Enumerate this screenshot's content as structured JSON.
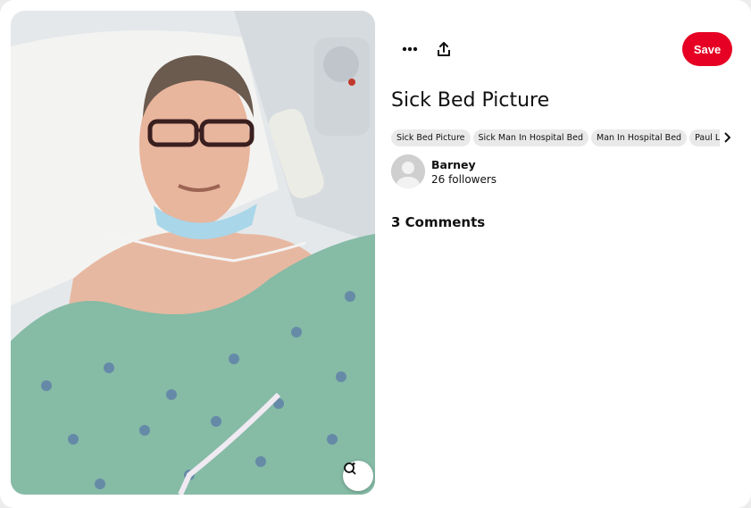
{
  "pin": {
    "title": "Sick Bed Picture",
    "image_alt": "Man in hospital bed wearing a hospital gown"
  },
  "toolbar": {
    "more_icon": "more-horizontal-icon",
    "share_icon": "share-upload-icon",
    "save_label": "Save"
  },
  "tags": [
    {
      "label": "Sick Bed Picture"
    },
    {
      "label": "Sick Man In Hospital Bed"
    },
    {
      "label": "Man In Hospital Bed"
    },
    {
      "label": "Paul Lacam"
    }
  ],
  "author": {
    "name": "Barney",
    "followers": "26 followers"
  },
  "comments": {
    "heading": "3 Comments"
  },
  "colors": {
    "save_red": "#e60023",
    "tag_bg": "#e9e9e9",
    "gown_green": "#86bba6"
  }
}
